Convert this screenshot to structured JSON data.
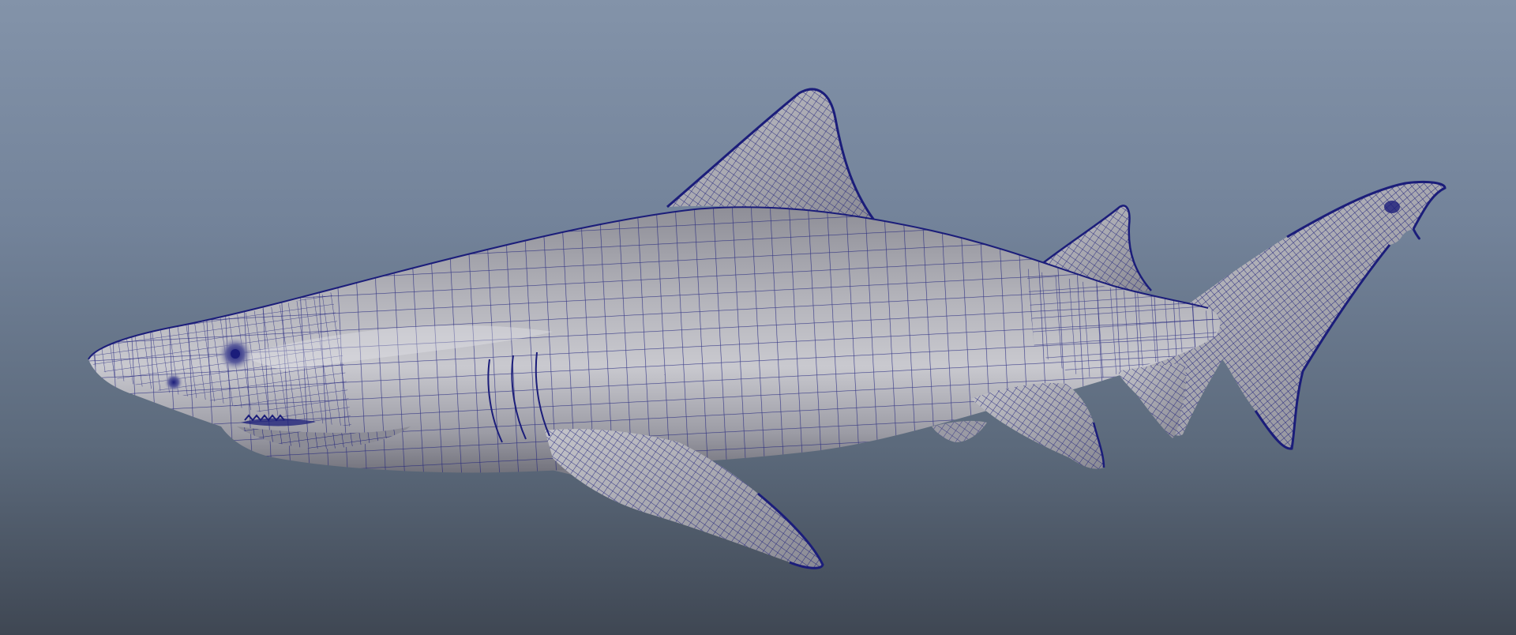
{
  "viewport": {
    "background_top": "#8393a9",
    "background_bottom": "#3f4753"
  },
  "model": {
    "icon": "shark-wireframe-icon",
    "surface_color": "#a9a9b1",
    "surface_highlight": "#d4d4da",
    "surface_shadow": "#6e6e78",
    "wireframe_color": "#1b1d7a"
  }
}
